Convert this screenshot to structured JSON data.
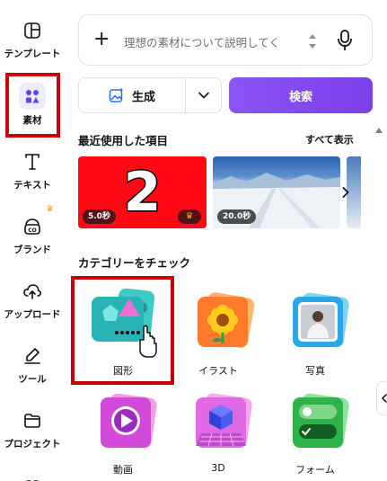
{
  "sidebar": {
    "items": [
      {
        "label": "テンプレート",
        "icon": "template-icon"
      },
      {
        "label": "素材",
        "icon": "elements-icon",
        "active": true
      },
      {
        "label": "テキスト",
        "icon": "text-icon"
      },
      {
        "label": "ブランド",
        "icon": "brand-icon",
        "premium": true
      },
      {
        "label": "アップロード",
        "icon": "upload-cloud-icon"
      },
      {
        "label": "ツール",
        "icon": "pen-tool-icon"
      },
      {
        "label": "プロジェクト",
        "icon": "folder-icon"
      }
    ]
  },
  "search": {
    "placeholder": "理想の素材について説明してく"
  },
  "actions": {
    "generate_label": "生成",
    "search_label": "検索"
  },
  "recent": {
    "title": "最近使用した項目",
    "see_all": "すべて表示",
    "items": [
      {
        "thumb_text": "2",
        "duration": "5.0秒",
        "premium": true
      },
      {
        "duration": "20.0秒"
      }
    ]
  },
  "categories": {
    "title": "カテゴリーをチェック",
    "items": [
      {
        "label": "図形"
      },
      {
        "label": "イラスト"
      },
      {
        "label": "写真"
      },
      {
        "label": "動画"
      },
      {
        "label": "3D"
      },
      {
        "label": "フォーム"
      }
    ]
  },
  "colors": {
    "accent": "#8a55f6",
    "highlight_box": "#c8000b",
    "recent_red": "#ff0a14"
  }
}
